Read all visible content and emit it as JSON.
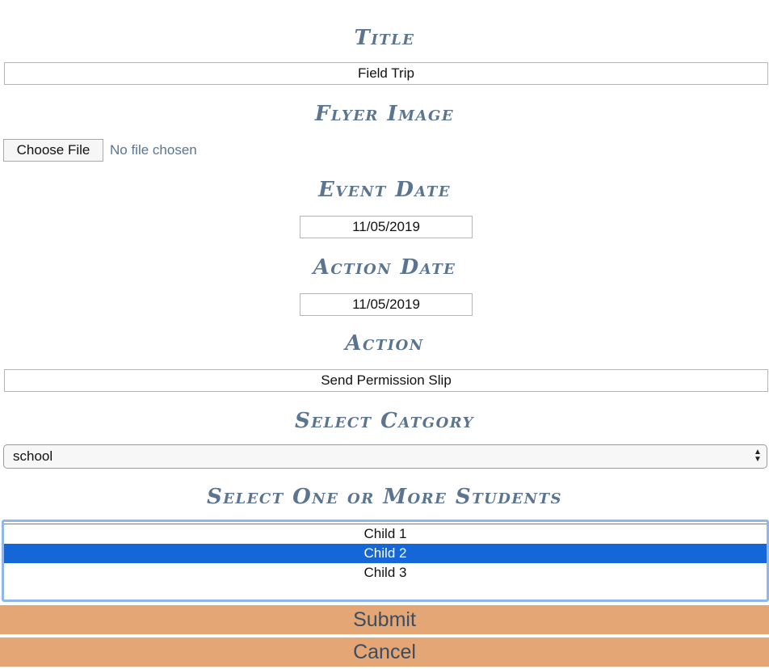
{
  "form": {
    "title_heading": "Title",
    "title_value": "Field Trip",
    "flyer_heading": "Flyer Image",
    "choose_file_label": "Choose File",
    "file_status": "No file chosen",
    "event_date_heading": "Event Date",
    "event_date_value": "11/05/2019",
    "action_date_heading": "Action Date",
    "action_date_value": "11/05/2019",
    "action_heading": "Action",
    "action_value": "Send Permission Slip",
    "category_heading": "Select Catgory",
    "category_selected": "school",
    "students_heading": "Select One or More Students",
    "students": [
      {
        "label": "Child 1",
        "selected": false
      },
      {
        "label": "Child 2",
        "selected": true
      },
      {
        "label": "Child 3",
        "selected": false
      }
    ],
    "submit_label": "Submit",
    "cancel_label": "Cancel"
  },
  "colors": {
    "heading": "#5b7590",
    "button_bg": "#e3a674",
    "button_text": "#3a4d63",
    "selected_option_bg": "#1567d8",
    "listbox_focus": "#8fb6ee"
  }
}
